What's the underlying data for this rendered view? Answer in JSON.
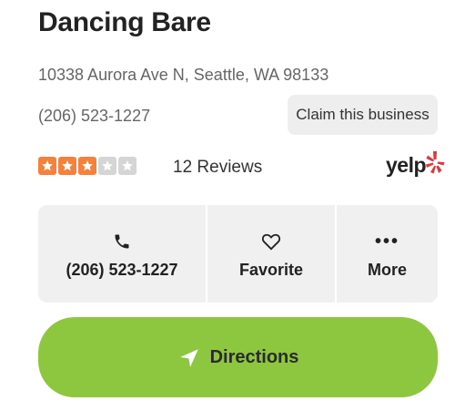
{
  "business": {
    "name": "Dancing Bare",
    "address": "10338 Aurora Ave N, Seattle, WA 98133",
    "phone": "(206) 523-1227",
    "claim_label": "Claim this business"
  },
  "rating": {
    "stars_filled": 3,
    "stars_total": 5,
    "reviews_label": "12 Reviews",
    "star_color": "#f5823c",
    "empty_star_color": "#d5d5d5"
  },
  "brand": {
    "logo_text": "yelp",
    "burst_color": "#e0373b"
  },
  "actions": {
    "call": {
      "icon": "phone-icon",
      "label": "(206) 523-1227"
    },
    "favorite": {
      "icon": "heart-icon",
      "label": "Favorite"
    },
    "more": {
      "icon": "more-dots-icon",
      "dots": "•••",
      "label": "More"
    }
  },
  "directions": {
    "icon": "navigation-arrow-icon",
    "label": "Directions",
    "color": "#8dc63f"
  }
}
